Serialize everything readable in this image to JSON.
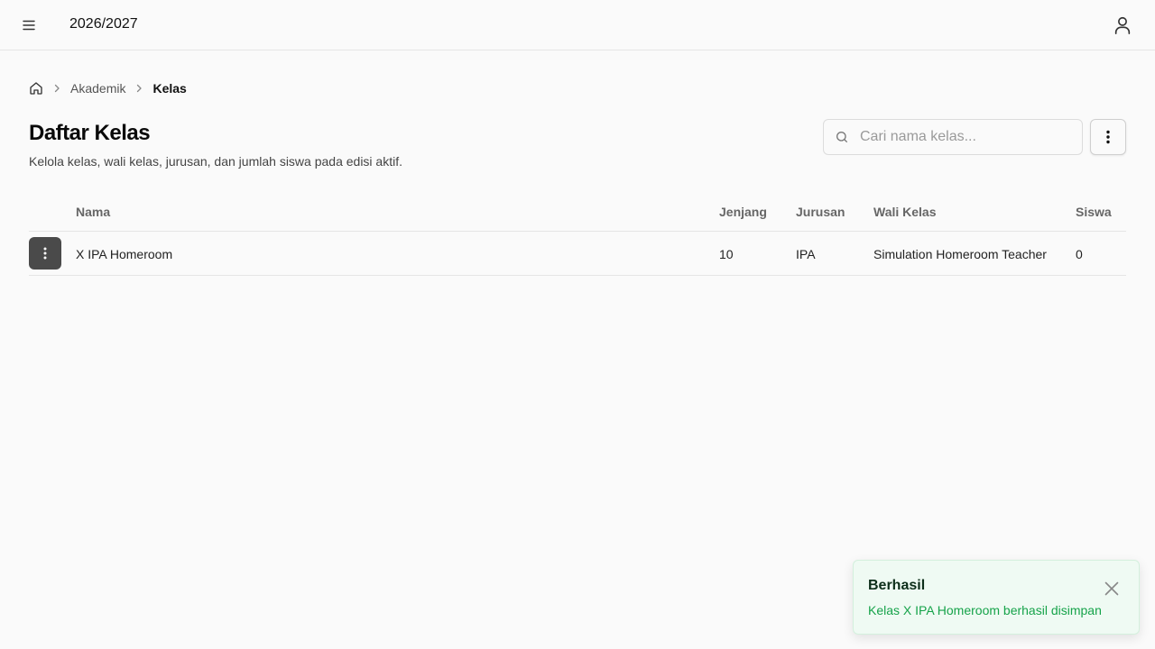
{
  "header": {
    "academic_year": "2026/2027",
    "menu_icon": "hamburger-menu-icon",
    "user_icon": "user-icon"
  },
  "breadcrumb": {
    "home_icon": "home-icon",
    "items": [
      "Akademik",
      "Kelas"
    ]
  },
  "page": {
    "title": "Daftar Kelas",
    "subtitle": "Kelola kelas, wali kelas, jurusan, dan jumlah siswa pada edisi aktif."
  },
  "search": {
    "placeholder": "Cari nama kelas...",
    "value": ""
  },
  "table": {
    "columns": [
      "Nama",
      "Jenjang",
      "Jurusan",
      "Wali Kelas",
      "Siswa"
    ],
    "rows": [
      {
        "nama": "X IPA Homeroom",
        "jenjang": "10",
        "jurusan": "IPA",
        "wali_kelas": "Simulation Homeroom Teacher",
        "siswa": "0"
      }
    ]
  },
  "toast": {
    "title": "Berhasil",
    "message": "Kelas X IPA Homeroom berhasil disimpan",
    "colors": {
      "background": "#effaf3",
      "message": "#16a34a"
    }
  }
}
